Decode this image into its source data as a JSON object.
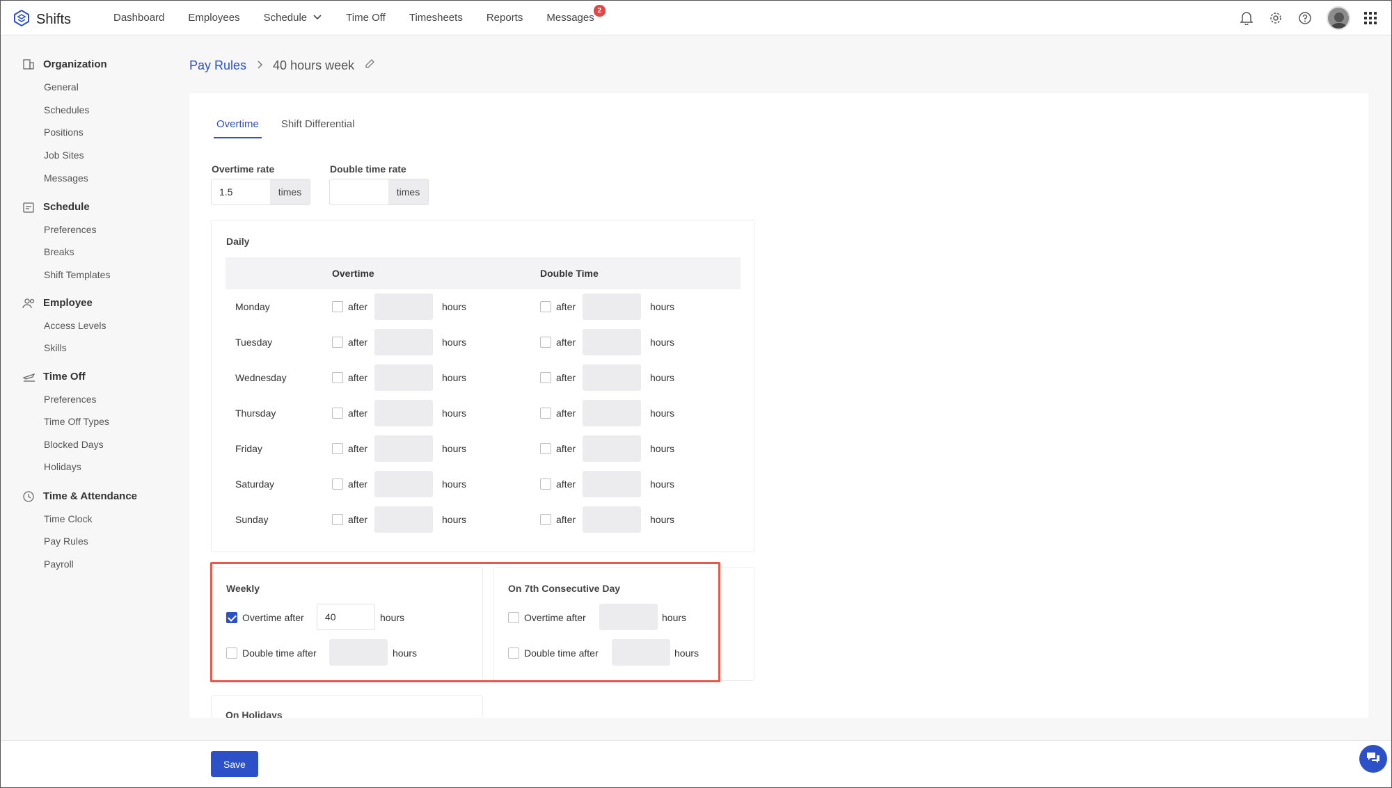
{
  "app": {
    "name": "Shifts"
  },
  "nav": {
    "items": [
      "Dashboard",
      "Employees",
      "Schedule",
      "Time Off",
      "Timesheets",
      "Reports",
      "Messages"
    ],
    "messages_badge": "2"
  },
  "sidebar": {
    "sections": [
      {
        "title": "Organization",
        "icon": "building-icon",
        "items": [
          "General",
          "Schedules",
          "Positions",
          "Job Sites",
          "Messages"
        ]
      },
      {
        "title": "Schedule",
        "icon": "calendar-icon",
        "items": [
          "Preferences",
          "Breaks",
          "Shift Templates"
        ]
      },
      {
        "title": "Employee",
        "icon": "users-icon",
        "items": [
          "Access Levels",
          "Skills"
        ]
      },
      {
        "title": "Time Off",
        "icon": "plane-icon",
        "items": [
          "Preferences",
          "Time Off Types",
          "Blocked Days",
          "Holidays"
        ]
      },
      {
        "title": "Time & Attendance",
        "icon": "clock-icon",
        "items": [
          "Time Clock",
          "Pay Rules",
          "Payroll"
        ]
      }
    ]
  },
  "breadcrumb": {
    "parent": "Pay Rules",
    "current": "40 hours week"
  },
  "tabs": {
    "overtime": "Overtime",
    "shift_differential": "Shift Differential"
  },
  "rates": {
    "overtime_label": "Overtime rate",
    "overtime_value": "1.5",
    "double_label": "Double time rate",
    "double_value": "",
    "suffix": "times"
  },
  "daily": {
    "title": "Daily",
    "col_overtime": "Overtime",
    "col_double": "Double Time",
    "after": "after",
    "hours": "hours",
    "days": [
      {
        "name": "Monday",
        "ot_checked": false,
        "dt_checked": false
      },
      {
        "name": "Tuesday",
        "ot_checked": false,
        "dt_checked": false
      },
      {
        "name": "Wednesday",
        "ot_checked": false,
        "dt_checked": false
      },
      {
        "name": "Thursday",
        "ot_checked": false,
        "dt_checked": false
      },
      {
        "name": "Friday",
        "ot_checked": false,
        "dt_checked": false
      },
      {
        "name": "Saturday",
        "ot_checked": false,
        "dt_checked": false
      },
      {
        "name": "Sunday",
        "ot_checked": false,
        "dt_checked": false
      }
    ]
  },
  "weekly": {
    "title": "Weekly",
    "overtime_label": "Overtime after",
    "overtime_checked": true,
    "overtime_value": "40",
    "double_label": "Double time after",
    "double_checked": false,
    "hours": "hours"
  },
  "seventh": {
    "title": "On 7th Consecutive Day",
    "overtime_label": "Overtime after",
    "double_label": "Double time after",
    "hours": "hours"
  },
  "holidays": {
    "title": "On Holidays"
  },
  "footer": {
    "save": "Save"
  }
}
